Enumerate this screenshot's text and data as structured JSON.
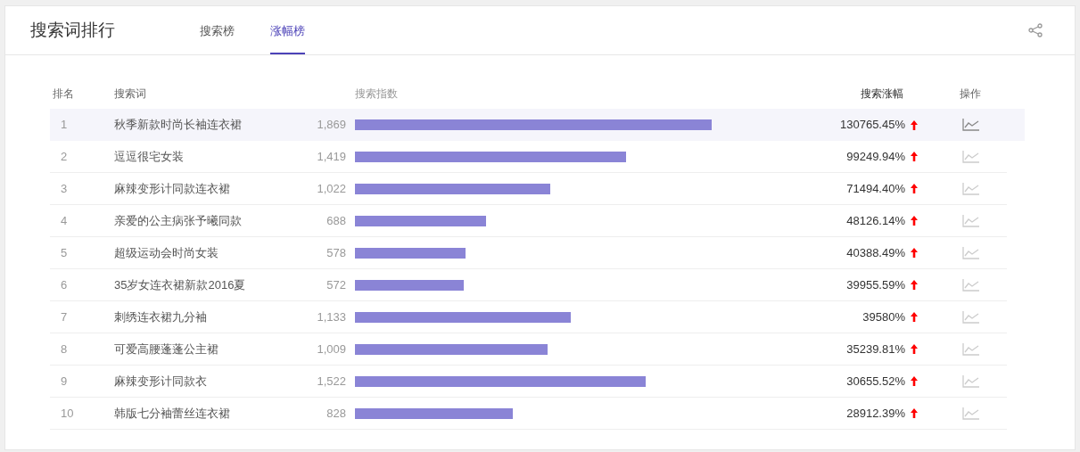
{
  "title": "搜索词排行",
  "tabs": [
    {
      "label": "搜索榜",
      "selected": false
    },
    {
      "label": "涨幅榜",
      "selected": true
    }
  ],
  "columns": {
    "rank": "排名",
    "word": "搜索词",
    "index": "搜索指数",
    "growth": "搜索涨幅",
    "action": "操作"
  },
  "rows": [
    {
      "rank": "1",
      "word": "秋季新款时尚长袖连衣裙",
      "index": "1,869",
      "growth": "130765.45%",
      "selected": true
    },
    {
      "rank": "2",
      "word": "逗逗很宅女装",
      "index": "1,419",
      "growth": "99249.94%",
      "selected": false
    },
    {
      "rank": "3",
      "word": "麻辣变形计同款连衣裙",
      "index": "1,022",
      "growth": "71494.40%",
      "selected": false
    },
    {
      "rank": "4",
      "word": "亲爱的公主病张予曦同款",
      "index": "688",
      "growth": "48126.14%",
      "selected": false
    },
    {
      "rank": "5",
      "word": "超级运动会时尚女装",
      "index": "578",
      "growth": "40388.49%",
      "selected": false
    },
    {
      "rank": "6",
      "word": "35岁女连衣裙新款2016夏",
      "index": "572",
      "growth": "39955.59%",
      "selected": false
    },
    {
      "rank": "7",
      "word": "刺绣连衣裙九分袖",
      "index": "1,133",
      "growth": "39580%",
      "selected": false
    },
    {
      "rank": "8",
      "word": "可爱高腰蓬蓬公主裙",
      "index": "1,009",
      "growth": "35239.81%",
      "selected": false
    },
    {
      "rank": "9",
      "word": "麻辣变形计同款衣",
      "index": "1,522",
      "growth": "30655.52%",
      "selected": false
    },
    {
      "rank": "10",
      "word": "韩版七分袖蕾丝连衣裙",
      "index": "828",
      "growth": "28912.39%",
      "selected": false
    }
  ]
}
